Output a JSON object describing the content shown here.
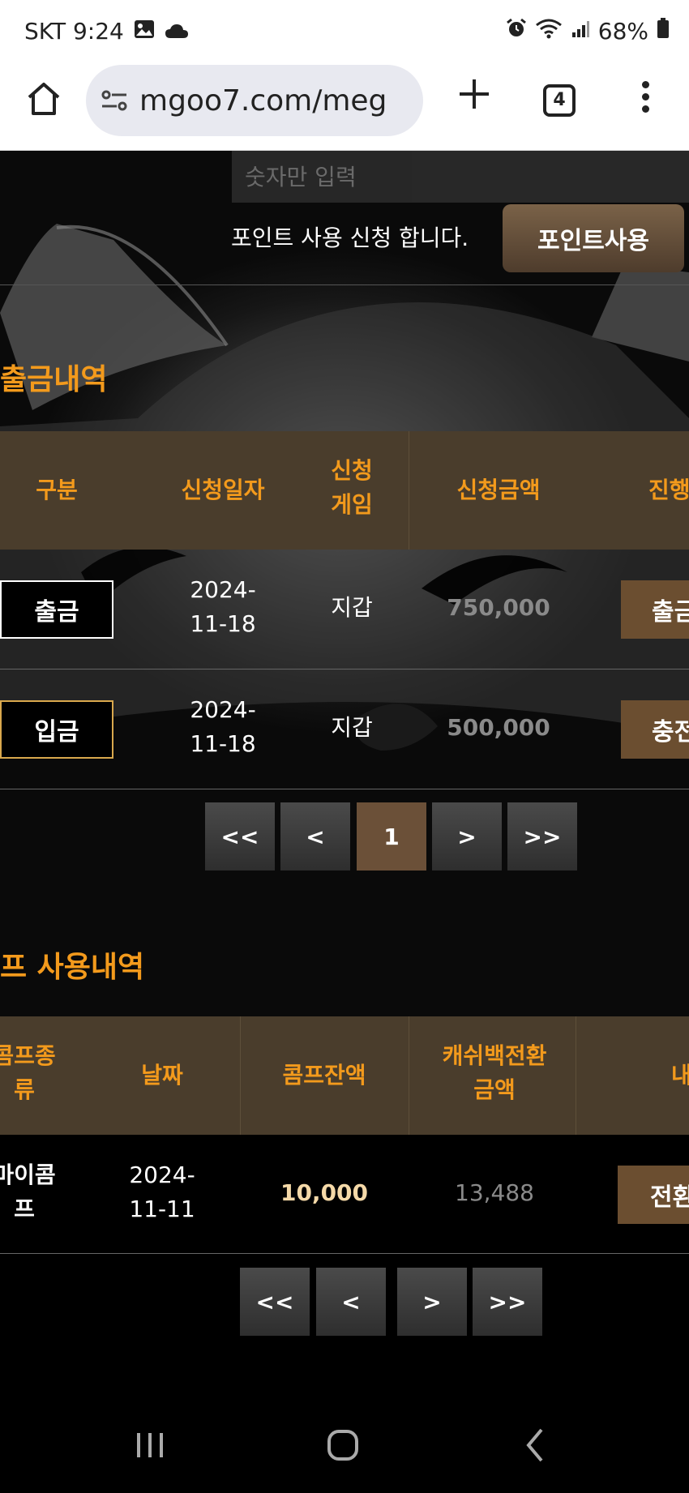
{
  "status_bar": {
    "carrier_time": "SKT 9:24",
    "battery": "68%",
    "icons": [
      "image-icon",
      "cloud-icon",
      "alarm-icon",
      "wifi-icon",
      "signal-icon",
      "battery-icon"
    ]
  },
  "browser": {
    "url": "mgoo7.com/meg",
    "tab_count": "4"
  },
  "points": {
    "input_placeholder": "숫자만 입력",
    "request_text": "포인트 사용 신청 합니다.",
    "button_label": "포인트사용"
  },
  "history": {
    "title": "출금내역",
    "headers": {
      "type": "구분",
      "date": "신청일자",
      "game_1": "신청",
      "game_2": "게임",
      "amount": "신청금액",
      "status": "진행"
    },
    "rows": [
      {
        "type": "출금",
        "date_1": "2024-",
        "date_2": "11-18",
        "game": "지갑",
        "amount": "750,000",
        "status": "출금"
      },
      {
        "type": "입금",
        "date_1": "2024-",
        "date_2": "11-18",
        "game": "지갑",
        "amount": "500,000",
        "status": "충전"
      }
    ],
    "pager": {
      "first": "<<",
      "prev": "<",
      "page": "1",
      "next": ">",
      "last": ">>"
    }
  },
  "comp": {
    "title": "프 사용내역",
    "headers": {
      "kind_1": "콤프종",
      "kind_2": "류",
      "date": "날짜",
      "balance": "콤프잔액",
      "cashback_1": "캐쉬백전환",
      "cashback_2": "금액",
      "detail": "내"
    },
    "rows": [
      {
        "kind_1": "마이콤",
        "kind_2": "프",
        "date_1": "2024-",
        "date_2": "11-11",
        "balance": "10,000",
        "cashback": "13,488",
        "action": "전환"
      }
    ],
    "pager": {
      "first": "<<",
      "prev": "<",
      "next": ">",
      "last": ">>"
    }
  },
  "colors": {
    "accent": "#f39a1c",
    "header_bg": "#4a3d2c",
    "brown_button": "#6b4e30"
  }
}
